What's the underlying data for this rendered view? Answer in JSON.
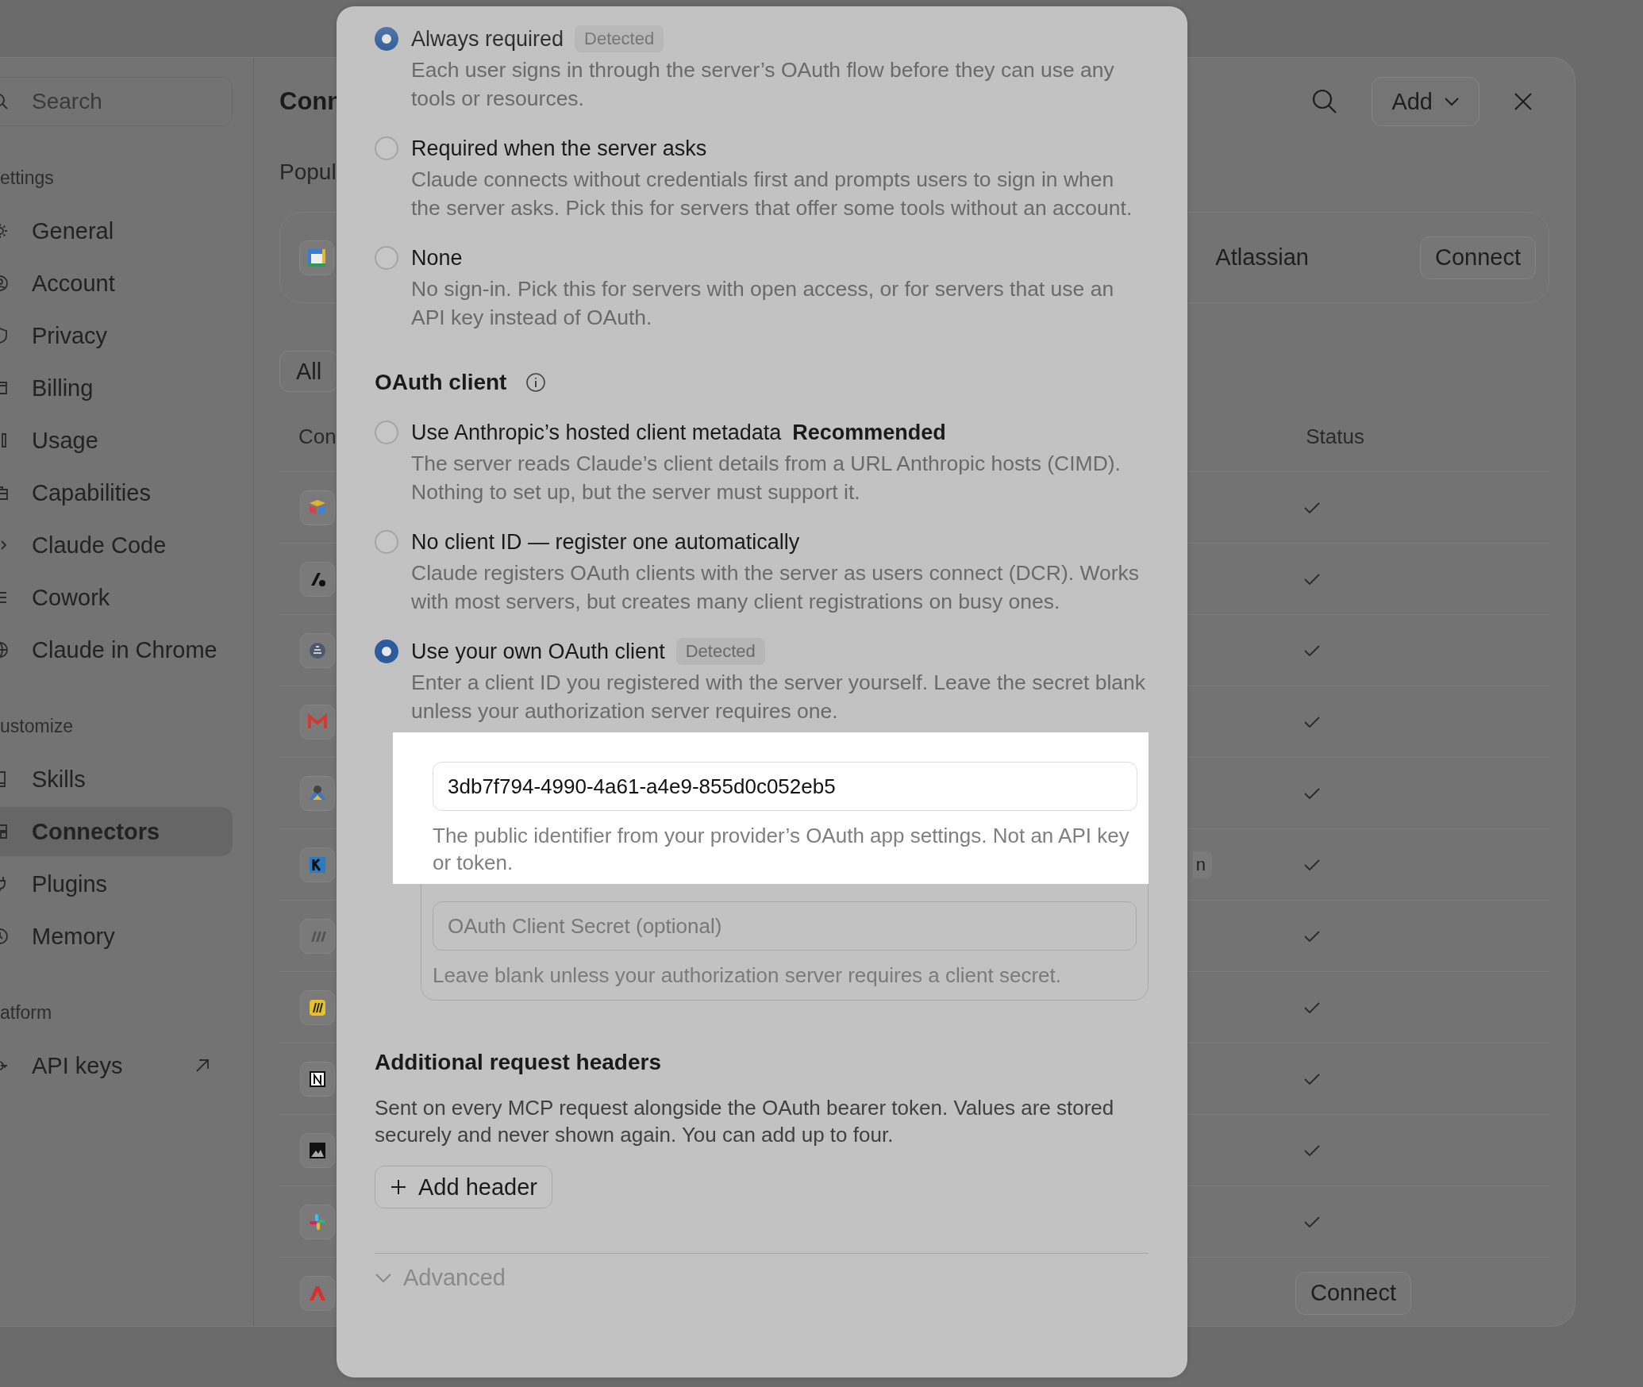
{
  "sidebar": {
    "search": {
      "placeholder": "Search"
    },
    "sections": [
      {
        "label": "ettings",
        "items": [
          {
            "label": "General",
            "selected": false
          },
          {
            "label": "Account",
            "selected": false
          },
          {
            "label": "Privacy",
            "selected": false
          },
          {
            "label": "Billing",
            "selected": false
          },
          {
            "label": "Usage",
            "selected": false
          },
          {
            "label": "Capabilities",
            "selected": false
          },
          {
            "label": "Claude Code",
            "selected": false
          },
          {
            "label": "Cowork",
            "selected": false
          },
          {
            "label": "Claude in Chrome",
            "selected": false
          }
        ]
      },
      {
        "label": "ustomize",
        "items": [
          {
            "label": "Skills",
            "selected": false
          },
          {
            "label": "Connectors",
            "selected": true
          },
          {
            "label": "Plugins",
            "selected": false
          },
          {
            "label": "Memory",
            "selected": false
          }
        ]
      },
      {
        "label": "atform",
        "items": [
          {
            "label": "API keys",
            "selected": false,
            "external": true
          }
        ]
      }
    ]
  },
  "main": {
    "title": "Conn",
    "add_button": "Add",
    "popular_label": "Popul",
    "featured": {
      "name": "Atlassian",
      "button": "Connect"
    },
    "filter": "All",
    "columns": [
      "Con",
      "Status"
    ],
    "rows": [
      {
        "kind": "check"
      },
      {
        "kind": "check"
      },
      {
        "kind": "check"
      },
      {
        "kind": "check"
      },
      {
        "kind": "check"
      },
      {
        "kind": "check",
        "badge": "n"
      },
      {
        "kind": "check"
      },
      {
        "kind": "check"
      },
      {
        "kind": "check"
      },
      {
        "kind": "check"
      },
      {
        "kind": "check"
      },
      {
        "kind": "button",
        "button": "Connect"
      }
    ]
  },
  "modal": {
    "auth_options": [
      {
        "label": "Always required",
        "badge": "Detected",
        "description": "Each user signs in through the server’s OAuth flow before they can use any tools or resources.",
        "selected": true
      },
      {
        "label": "Required when the server asks",
        "description": "Claude connects without credentials first and prompts users to sign in when the server asks. Pick this for servers that offer some tools without an account.",
        "selected": false
      },
      {
        "label": "None",
        "description": "No sign-in. Pick this for servers with open access, or for servers that use an API key instead of OAuth.",
        "selected": false
      }
    ],
    "oauth_client": {
      "title": "OAuth client",
      "options": [
        {
          "label": "Use Anthropic’s hosted client metadata",
          "tag": "Recommended",
          "description": "The server reads Claude’s client details from a URL Anthropic hosts (CIMD). Nothing to set up, but the server must support it.",
          "selected": false
        },
        {
          "label": "No client ID — register one automatically",
          "description": "Claude registers OAuth clients with the server as users connect (DCR). Works with most servers, but creates many client registrations on busy ones.",
          "selected": false
        },
        {
          "label": "Use your own OAuth client",
          "badge": "Detected",
          "description": "Enter a client ID you registered with the server yourself. Leave the secret blank unless your authorization server requires one.",
          "selected": true
        }
      ]
    },
    "client_id": {
      "value": "3db7f794-4990-4a61-a4e9-855d0c052eb5",
      "help": "The public identifier from your provider’s OAuth app settings. Not an API key or token."
    },
    "client_secret": {
      "placeholder": "OAuth Client Secret (optional)",
      "help": "Leave blank unless your authorization server requires a client secret."
    },
    "headers": {
      "title": "Additional request headers",
      "description": "Sent on every MCP request alongside the OAuth bearer token. Values are stored securely and never shown again. You can add up to four.",
      "button": "Add header"
    },
    "advanced": {
      "label": "Advanced",
      "expanded": false
    }
  }
}
